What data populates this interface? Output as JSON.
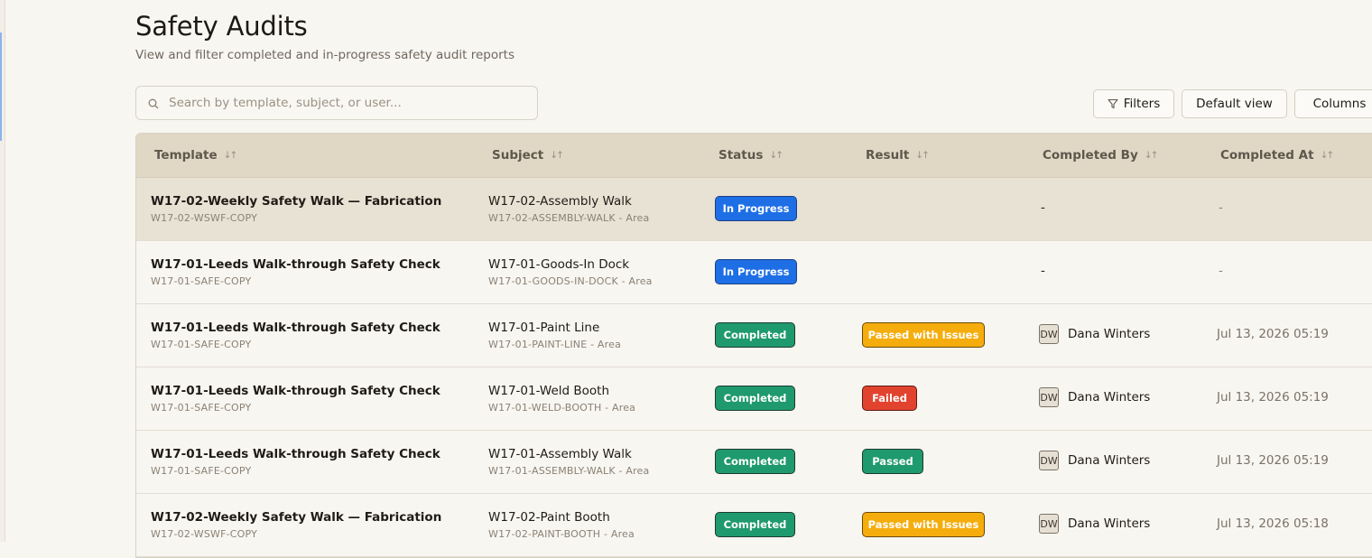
{
  "page": {
    "title": "Safety Audits",
    "subtitle": "View and filter completed and in-progress safety audit reports"
  },
  "toolbar": {
    "search_placeholder": "Search by template, subject, or user...",
    "filters_label": "Filters",
    "default_view_label": "Default view",
    "columns_label": "Columns"
  },
  "table": {
    "headers": [
      "Template",
      "Subject",
      "Status",
      "Result",
      "Completed By",
      "Completed At"
    ],
    "rows": [
      {
        "template": "W17-02-Weekly Safety Walk — Fabrication",
        "template_code": "W17-02-WSWF-COPY",
        "subject": "W17-02-Assembly Walk",
        "subject_code": "W17-02-ASSEMBLY-WALK - Area",
        "status": "In Progress",
        "result": "",
        "completed_by": "-",
        "initials": "",
        "completed_at": "-"
      },
      {
        "template": "W17-01-Leeds Walk-through Safety Check",
        "template_code": "W17-01-SAFE-COPY",
        "subject": "W17-01-Goods-In Dock",
        "subject_code": "W17-01-GOODS-IN-DOCK - Area",
        "status": "In Progress",
        "result": "",
        "completed_by": "-",
        "initials": "",
        "completed_at": "-"
      },
      {
        "template": "W17-01-Leeds Walk-through Safety Check",
        "template_code": "W17-01-SAFE-COPY",
        "subject": "W17-01-Paint Line",
        "subject_code": "W17-01-PAINT-LINE - Area",
        "status": "Completed",
        "result": "Passed with Issues",
        "completed_by": "Dana Winters",
        "initials": "DW",
        "completed_at": "Jul 13, 2026 05:19"
      },
      {
        "template": "W17-01-Leeds Walk-through Safety Check",
        "template_code": "W17-01-SAFE-COPY",
        "subject": "W17-01-Weld Booth",
        "subject_code": "W17-01-WELD-BOOTH - Area",
        "status": "Completed",
        "result": "Failed",
        "completed_by": "Dana Winters",
        "initials": "DW",
        "completed_at": "Jul 13, 2026 05:19"
      },
      {
        "template": "W17-01-Leeds Walk-through Safety Check",
        "template_code": "W17-01-SAFE-COPY",
        "subject": "W17-01-Assembly Walk",
        "subject_code": "W17-01-ASSEMBLY-WALK - Area",
        "status": "Completed",
        "result": "Passed",
        "completed_by": "Dana Winters",
        "initials": "DW",
        "completed_at": "Jul 13, 2026 05:19"
      },
      {
        "template": "W17-02-Weekly Safety Walk — Fabrication",
        "template_code": "W17-02-WSWF-COPY",
        "subject": "W17-02-Paint Booth",
        "subject_code": "W17-02-PAINT-BOOTH - Area",
        "status": "Completed",
        "result": "Passed with Issues",
        "completed_by": "Dana Winters",
        "initials": "DW",
        "completed_at": "Jul 13, 2026 05:18"
      }
    ]
  },
  "colors": {
    "in_progress": "#1e6fe6",
    "completed": "#1f9a6e",
    "passed_with_issues": "#f5ad0d",
    "failed": "#e2432f",
    "passed": "#1f9a6e",
    "header_bg": "#e0d7c5"
  },
  "icons": {
    "search": "search-icon",
    "filter": "filter-icon",
    "sort": "sort-icon"
  }
}
